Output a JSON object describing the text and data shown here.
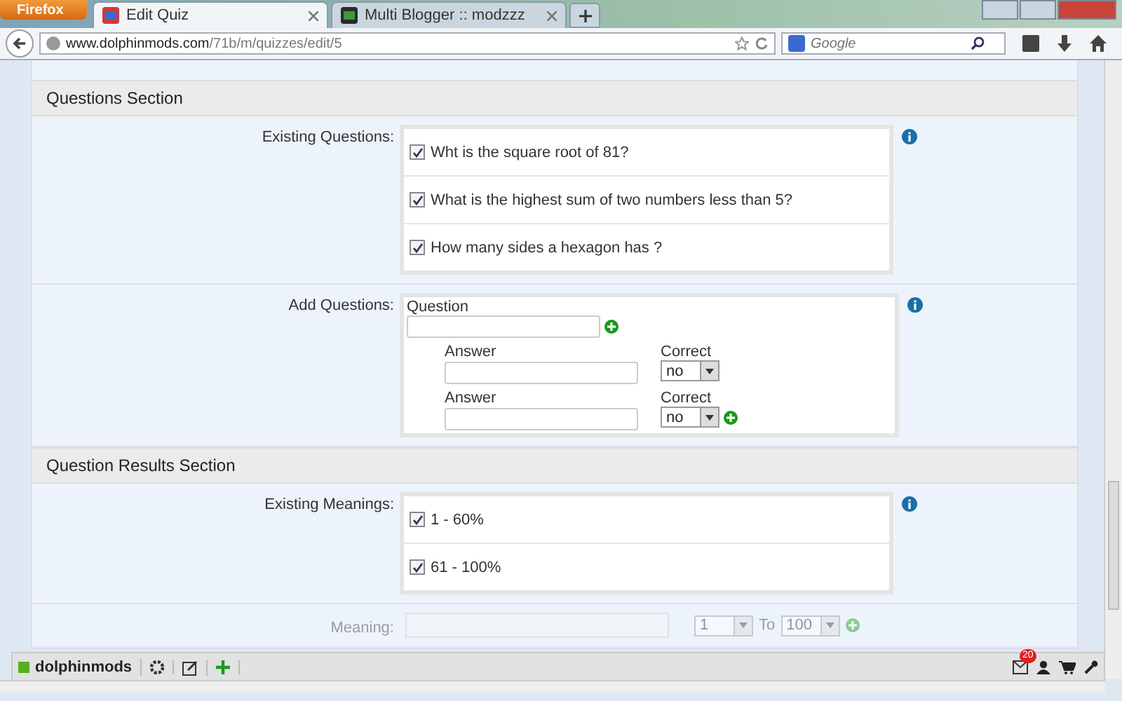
{
  "browser": {
    "menu_button": "Firefox",
    "tabs": [
      {
        "title": "Edit Quiz",
        "selected": true
      },
      {
        "title": "Multi Blogger :: modzzz",
        "selected": false
      }
    ],
    "url_host": "www.dolphinmods.com",
    "url_path": "/71b/m/quizzes/edit/5",
    "search_placeholder": "Google"
  },
  "sections": [
    {
      "title": "Questions Section",
      "rows": [
        {
          "kind": "checklist",
          "label": "Existing Questions:",
          "items": [
            {
              "text": "Wht is the square root of 81?",
              "checked": true
            },
            {
              "text": "What is the highest sum of two numbers less than 5?",
              "checked": true
            },
            {
              "text": "How many sides a hexagon has ?",
              "checked": true
            }
          ]
        },
        {
          "kind": "add_question",
          "label": "Add Questions:",
          "question_label": "Question",
          "answers": [
            {
              "label": "Answer",
              "correct_label": "Correct",
              "correct_value": "no"
            },
            {
              "label": "Answer",
              "correct_label": "Correct",
              "correct_value": "no"
            }
          ]
        }
      ]
    },
    {
      "title": "Question Results Section",
      "rows": [
        {
          "kind": "checklist",
          "label": "Existing Meanings:",
          "items": [
            {
              "text": "1 - 60%",
              "checked": true
            },
            {
              "text": "61 - 100%",
              "checked": true
            }
          ]
        },
        {
          "kind": "range",
          "label": "Meaning:",
          "from": "1",
          "to_label": "To",
          "to": "100"
        }
      ]
    }
  ],
  "toolbar": {
    "site": "dolphinmods",
    "badge": "20"
  }
}
